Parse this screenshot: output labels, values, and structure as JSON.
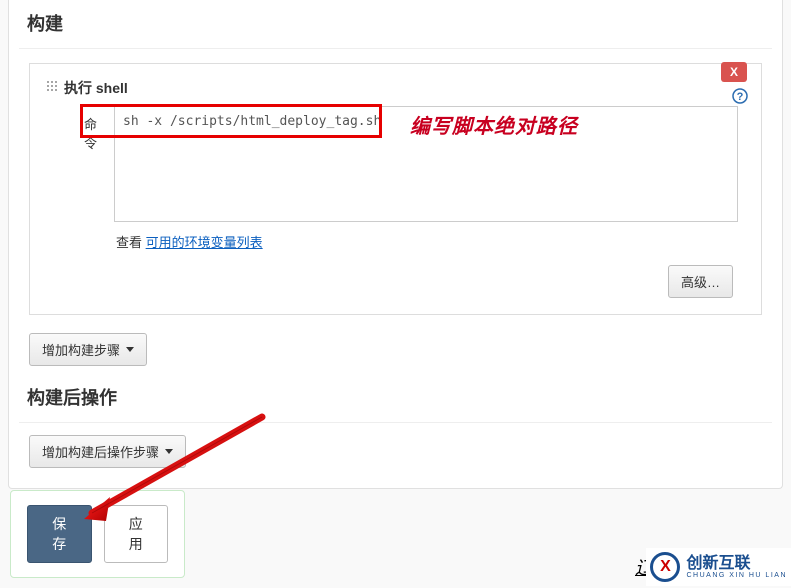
{
  "build": {
    "title": "构建",
    "block": {
      "header": "执行 shell",
      "cmd_label": "命令",
      "cmd_value": "sh -x /scripts/html_deploy_tag.sh",
      "see_prefix": "查看 ",
      "see_link": "可用的环境变量列表",
      "advanced_label": "高级…",
      "delete_label": "X"
    },
    "add_step_label": "增加构建步骤"
  },
  "post_build": {
    "title": "构建后操作",
    "add_step_label": "增加构建后操作步骤"
  },
  "actions": {
    "save": "保存",
    "apply": "应用"
  },
  "annotation": "编写脚本绝对路径",
  "logo": {
    "mark": "X",
    "cn": "创新互联",
    "en": "CHUANG XIN HU LIAN"
  },
  "small_mark": "辽"
}
